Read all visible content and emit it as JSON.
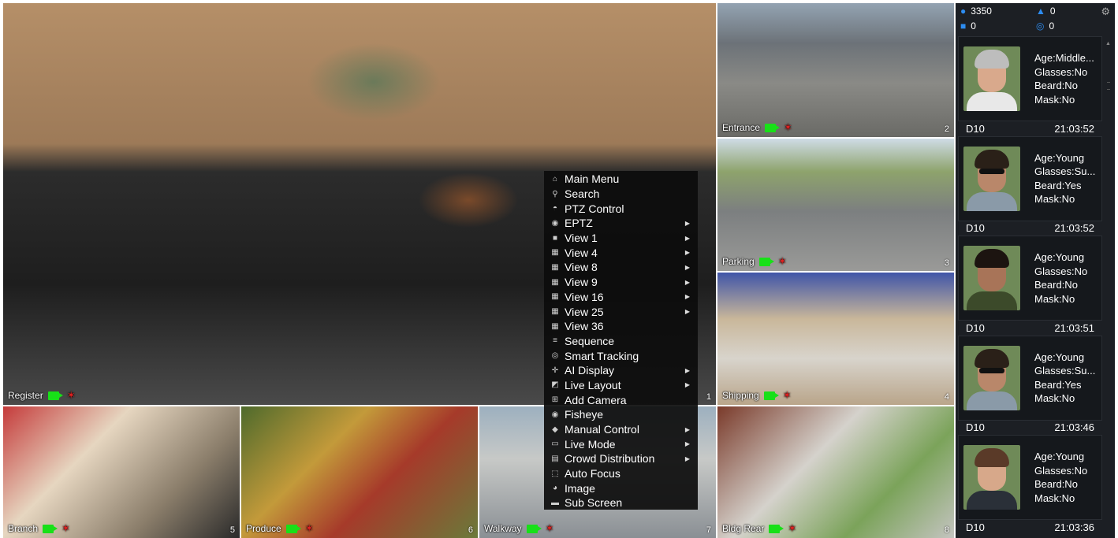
{
  "cameras": [
    {
      "name": "Register",
      "num": "1"
    },
    {
      "name": "Entrance",
      "num": "2"
    },
    {
      "name": "Parking",
      "num": "3"
    },
    {
      "name": "Shipping",
      "num": "4"
    },
    {
      "name": "Branch",
      "num": "5"
    },
    {
      "name": "Produce",
      "num": "6"
    },
    {
      "name": "Walkway",
      "num": "7"
    },
    {
      "name": "Bldg Rear",
      "num": "8"
    }
  ],
  "menu": {
    "items": [
      {
        "label": "Main Menu",
        "icon": "home-icon",
        "submenu": false
      },
      {
        "label": "Search",
        "icon": "search-icon",
        "submenu": false
      },
      {
        "label": "PTZ Control",
        "icon": "ptz-icon",
        "submenu": false
      },
      {
        "label": "EPTZ",
        "icon": "eptz-icon",
        "submenu": true
      },
      {
        "label": "View 1",
        "icon": "view1-icon",
        "submenu": true
      },
      {
        "label": "View 4",
        "icon": "view4-icon",
        "submenu": true
      },
      {
        "label": "View 8",
        "icon": "view8-icon",
        "submenu": true
      },
      {
        "label": "View 9",
        "icon": "view9-icon",
        "submenu": true
      },
      {
        "label": "View 16",
        "icon": "view16-icon",
        "submenu": true
      },
      {
        "label": "View 25",
        "icon": "view25-icon",
        "submenu": true
      },
      {
        "label": "View 36",
        "icon": "view36-icon",
        "submenu": false
      },
      {
        "label": "Sequence",
        "icon": "sequence-icon",
        "submenu": false
      },
      {
        "label": "Smart Tracking",
        "icon": "smart-tracking-icon",
        "submenu": false
      },
      {
        "label": "AI Display",
        "icon": "ai-display-icon",
        "submenu": true
      },
      {
        "label": "Live Layout",
        "icon": "live-layout-icon",
        "submenu": true
      },
      {
        "label": "Add Camera",
        "icon": "add-camera-icon",
        "submenu": false
      },
      {
        "label": "Fisheye",
        "icon": "fisheye-icon",
        "submenu": false
      },
      {
        "label": "Manual Control",
        "icon": "manual-control-icon",
        "submenu": true
      },
      {
        "label": "Live Mode",
        "icon": "live-mode-icon",
        "submenu": true
      },
      {
        "label": "Crowd Distribution",
        "icon": "crowd-icon",
        "submenu": true
      },
      {
        "label": "Auto Focus",
        "icon": "auto-focus-icon",
        "submenu": false
      },
      {
        "label": "Image",
        "icon": "image-icon",
        "submenu": false
      },
      {
        "label": "Sub Screen",
        "icon": "sub-screen-icon",
        "submenu": false
      }
    ]
  },
  "stats": {
    "people": "3350",
    "nonmotor_people": "0",
    "vehicles": "0",
    "bikes": "0"
  },
  "faces": [
    {
      "age": "Age:Middle...",
      "glasses": "Glasses:No",
      "beard": "Beard:No",
      "mask": "Mask:No",
      "channel": "D10",
      "time": "21:03:52",
      "skin": "#d9a98c",
      "hair": "#bdbdbd",
      "shirt": "#e8e8e8",
      "sunglasses": false
    },
    {
      "age": "Age:Young",
      "glasses": "Glasses:Su...",
      "beard": "Beard:Yes",
      "mask": "Mask:No",
      "channel": "D10",
      "time": "21:03:52",
      "skin": "#b9876a",
      "hair": "#2a2018",
      "shirt": "#8a9aa8",
      "sunglasses": true
    },
    {
      "age": "Age:Young",
      "glasses": "Glasses:No",
      "beard": "Beard:No",
      "mask": "Mask:No",
      "channel": "D10",
      "time": "21:03:51",
      "skin": "#a87458",
      "hair": "#1c1410",
      "shirt": "#3c4a2a",
      "sunglasses": false
    },
    {
      "age": "Age:Young",
      "glasses": "Glasses:Su...",
      "beard": "Beard:Yes",
      "mask": "Mask:No",
      "channel": "D10",
      "time": "21:03:46",
      "skin": "#b9876a",
      "hair": "#2a2018",
      "shirt": "#8a9aa8",
      "sunglasses": true
    },
    {
      "age": "Age:Young",
      "glasses": "Glasses:No",
      "beard": "Beard:No",
      "mask": "Mask:No",
      "channel": "D10",
      "time": "21:03:36",
      "skin": "#d7a88a",
      "hair": "#5a3a28",
      "shirt": "#2a3038",
      "sunglasses": false
    }
  ]
}
